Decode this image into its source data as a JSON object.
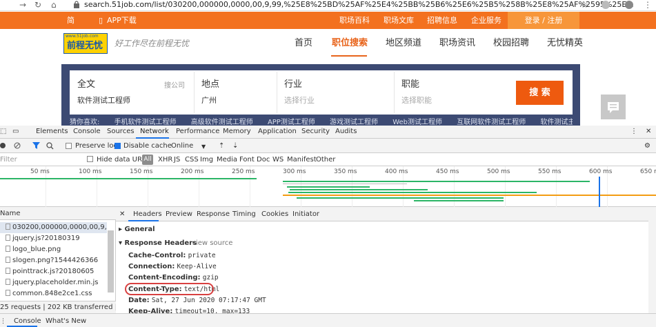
{
  "browser": {
    "url": "search.51job.com/list/030200,000000,0000,00,9,99,%25E8%25BD%25AF%25E4%25BB%25B6%25E6%25B5%258B%25E8%25AF%2595%25E..."
  },
  "site": {
    "topbar": {
      "left_char": "简",
      "app_download": "APP下载",
      "links": [
        "职场百科",
        "职场文库",
        "招聘信息",
        "企业服务"
      ],
      "login": "登录 / 注册"
    },
    "logo": {
      "small": "www.51job.com",
      "main": "前程无忧"
    },
    "slogan": "好工作尽在前程无忧",
    "nav": [
      "首页",
      "职位搜索",
      "地区频道",
      "职场资讯",
      "校园招聘",
      "无忧精英"
    ],
    "search": {
      "fields": [
        {
          "label": "全文",
          "sub": "搜公司",
          "value": "软件测试工程师"
        },
        {
          "label": "地点",
          "value": "广州"
        },
        {
          "label": "行业",
          "placeholder": "选择行业"
        },
        {
          "label": "职能",
          "placeholder": "选择职能"
        }
      ],
      "button": "搜 索",
      "hot_label": "猜你喜欢:",
      "hot": [
        "手机软件测试工程师",
        "高级软件测试工程师",
        "APP测试工程师",
        "游戏测试工程师",
        "Web测试工程师",
        "互联网软件测试工程师",
        "软件测试主管"
      ]
    }
  },
  "devtools": {
    "tabs": [
      "Elements",
      "Console",
      "Sources",
      "Network",
      "Performance",
      "Memory",
      "Application",
      "Security",
      "Audits"
    ],
    "toolbar": {
      "preserve_log": "Preserve log",
      "disable_cache": "Disable cache",
      "throttle": "Online"
    },
    "filter": {
      "placeholder": "Filter",
      "hide_data_urls": "Hide data URLs",
      "types": [
        "All",
        "XHR",
        "JS",
        "CSS",
        "Img",
        "Media",
        "Font",
        "Doc",
        "WS",
        "Manifest",
        "Other"
      ]
    },
    "timeline_ticks": [
      "50 ms",
      "100 ms",
      "150 ms",
      "200 ms",
      "250 ms",
      "300 ms",
      "350 ms",
      "400 ms",
      "450 ms",
      "500 ms",
      "550 ms",
      "600 ms",
      "650 m"
    ],
    "requests_header": "Name",
    "requests": [
      "030200,000000,0000,00,9,99,%25E8%",
      "jquery.js?20180319",
      "logo_blue.png",
      "slogen.png?1544426366",
      "pointtrack.js?20180605",
      "jquery.placeholder.min.js",
      "common.848e2ce1.css"
    ],
    "requests_footer": "25 requests | 202 KB transferred | 597 K",
    "detail_tabs": [
      "Headers",
      "Preview",
      "Response",
      "Timing",
      "Cookies",
      "Initiator"
    ],
    "general": "General",
    "response_headers": "Response Headers",
    "view_source": "view source",
    "headers": [
      {
        "name": "Cache-Control:",
        "value": "private"
      },
      {
        "name": "Connection:",
        "value": "Keep-Alive"
      },
      {
        "name": "Content-Encoding:",
        "value": "gzip"
      },
      {
        "name": "Content-Type:",
        "value": "text/html"
      },
      {
        "name": "Date:",
        "value": "Sat, 27 Jun 2020 07:17:47 GMT"
      },
      {
        "name": "Keep-Alive:",
        "value": "timeout=10, max=133"
      }
    ],
    "drawer_tabs": [
      "Console",
      "What's New"
    ]
  },
  "colors": {
    "site_orange": "#f3711f",
    "devtools_blue": "#1a73e8",
    "highlight_red": "#d84040"
  }
}
